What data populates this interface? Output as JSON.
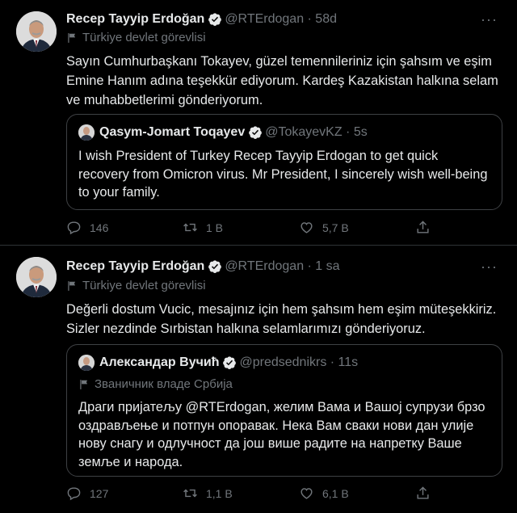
{
  "tweets": [
    {
      "author_name": "Recep Tayyip Erdoğan",
      "handle_time": "@RTErdogan · 58d",
      "label": "Türkiye devlet görevlisi",
      "text": "Sayın Cumhurbaşkanı Tokayev, güzel temennileriniz için şahsım ve eşim Emine Hanım adına teşekkür ediyorum. Kardeş Kazakistan halkına selam ve muhabbetlerimi gönderiyorum.",
      "quote": {
        "author_name": "Qasym-Jomart Toqayev",
        "handle_time": "@TokayevKZ · 5s",
        "label": "",
        "text": "I wish President of Turkey Recep Tayyip Erdogan to get quick recovery from Omicron virus. Mr President, I sincerely wish well-being to your family."
      },
      "actions": {
        "replies": "146",
        "retweets": "1 B",
        "likes": "5,7 B"
      }
    },
    {
      "author_name": "Recep Tayyip Erdoğan",
      "handle_time": "@RTErdogan · 1 sa",
      "label": "Türkiye devlet görevlisi",
      "text": "Değerli dostum Vucic, mesajınız için hem şahsım hem eşim müteşekkiriz. Sizler nezdinde Sırbistan halkına selamlarımızı gönderiyoruz.",
      "quote": {
        "author_name": "Александар Вучић",
        "handle_time": "@predsednikrs · 11s",
        "label": "Званичник владе Србија",
        "text": "Драги пријатељу @RTErdogan, желим Вама и Вашој супрузи брзо оздрављење и потпун опоравак. Нека Вам сваки нови дан улије нову снагу и одлучност да још више радите на напретку Ваше земље и народа."
      },
      "actions": {
        "replies": "127",
        "retweets": "1,1 B",
        "likes": "6,1 B"
      }
    }
  ],
  "icons": {
    "verified": "verified-badge-icon",
    "label_flag": "flag-icon",
    "reply": "reply-icon",
    "retweet": "retweet-icon",
    "like": "heart-icon",
    "share": "share-icon",
    "more": "more-icon"
  },
  "colors": {
    "background": "#000000",
    "text": "#e7e9ea",
    "muted": "#71767b",
    "verified": "#1d9bf0"
  }
}
